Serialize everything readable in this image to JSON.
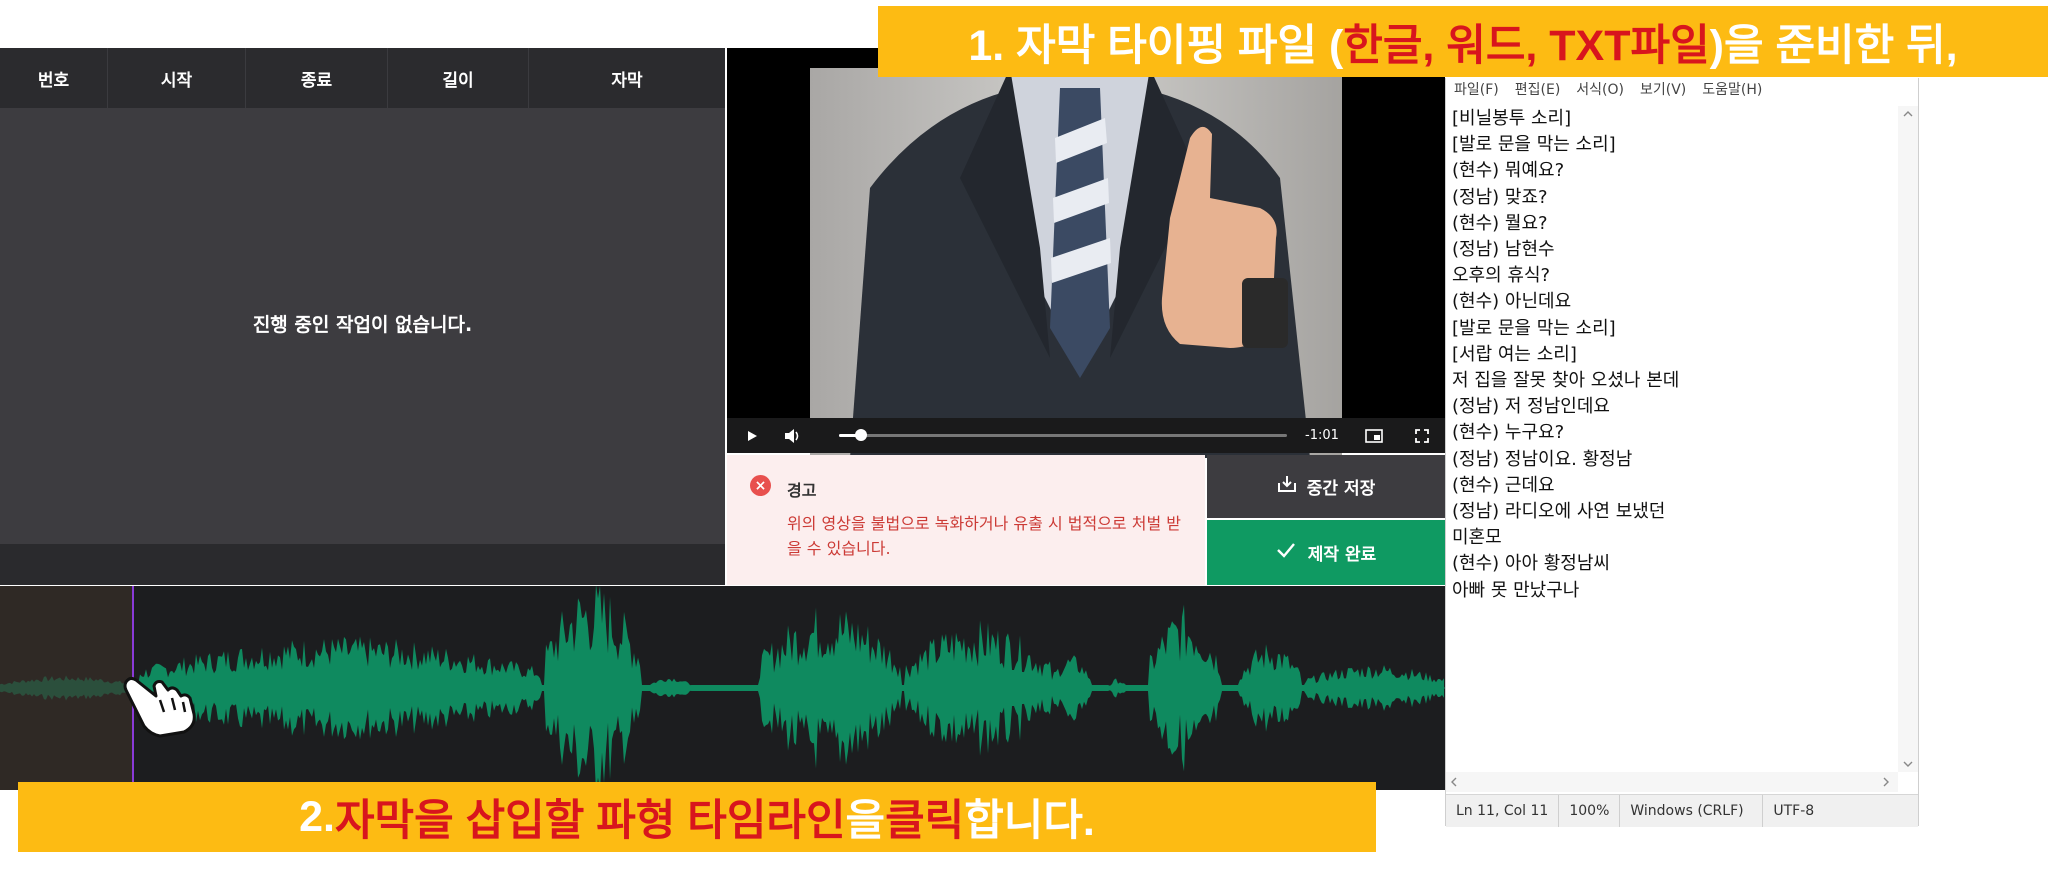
{
  "subtitle_table": {
    "columns": [
      "번호",
      "시작",
      "종료",
      "길이",
      "자막"
    ],
    "empty_message": "진행 중인 작업이 없습니다."
  },
  "player": {
    "time_remaining": "-1:01",
    "progress": 0.05
  },
  "warning": {
    "title": "경고",
    "body": "위의 영상을 불법으로 녹화하거나 유출 시 법적으로 처벌 받을 수 있습니다."
  },
  "buttons": {
    "save": "중간 저장",
    "done": "제작 완료"
  },
  "notepad": {
    "menu": [
      "파일(F)",
      "편집(E)",
      "서식(O)",
      "보기(V)",
      "도움말(H)"
    ],
    "lines": [
      "[비닐봉투 소리]",
      "[발로 문을 막는 소리]",
      "(현수) 뭐예요?",
      "(정남) 맞죠?",
      "(현수) 뭘요?",
      "(정남) 남현수",
      "오후의 휴식?",
      "(현수) 아닌데요",
      "[발로 문을 막는 소리]",
      "[서랍 여는 소리]",
      "저 집을 잘못 찾아 오셨나 본데",
      "(정남) 저 정남인데요",
      "(현수) 누구요?",
      "(정남) 정남이요. 황정남",
      "(현수) 근데요",
      "(정남) 라디오에 사연 보냈던",
      "미혼모",
      "(현수) 아아 황정남씨",
      "아빠 못 만났구나"
    ],
    "status": {
      "position": "Ln 11, Col 11",
      "zoom": "100%",
      "line_ending": "Windows (CRLF)",
      "encoding": "UTF-8"
    }
  },
  "banner1": {
    "prefix": "1. 자막 타이핑 파일 (",
    "highlight": "한글, 워드, TXT파일",
    "suffix": ")을 준비한 뒤,"
  },
  "banner2": {
    "prefix": "2. ",
    "highlight1": "자막을 삽입할 파형 타임라인",
    "mid": "을 ",
    "highlight2": "클릭",
    "suffix": "합니다."
  },
  "colors": {
    "banner": "#fdbb13",
    "banner_highlight": "#d8151d",
    "waveform": "#0f8a5f",
    "done_button": "#0f9a62",
    "warning_text": "#cc3b36"
  }
}
